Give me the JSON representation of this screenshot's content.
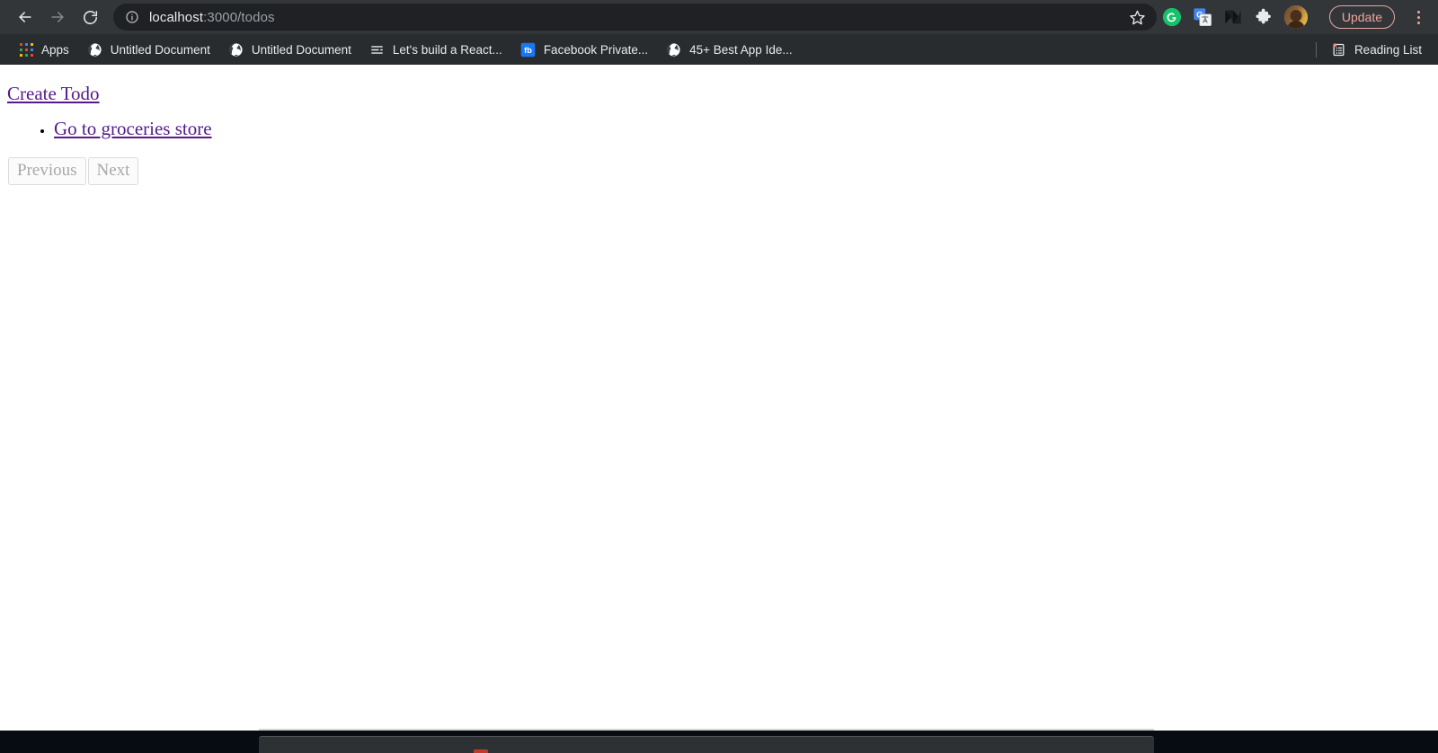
{
  "browser": {
    "toolbar": {
      "back_label": "Back",
      "forward_label": "Forward",
      "reload_label": "Reload",
      "info_label": "Site information",
      "url_host": "localhost",
      "url_rest": ":3000/todos",
      "bookmark_star_label": "Bookmark this tab",
      "extensions": [
        {
          "name": "grammarly-extension-icon",
          "label": "Grammarly"
        },
        {
          "name": "google-translate-extension-icon",
          "label": "Google Translate"
        },
        {
          "name": "medium-extension-icon",
          "label": "Medium"
        },
        {
          "name": "extensions-puzzle-icon",
          "label": "Extensions"
        }
      ],
      "avatar_label": "Profile",
      "update_label": "Update",
      "menu_label": "Customize and control Google Chrome",
      "accent_update": "#f0a39c",
      "bg_toolbar": "#323639",
      "bg_omnibox": "#202124"
    },
    "bookmarks_bar": {
      "bg": "#292c2f",
      "items": [
        {
          "label": "Apps",
          "icon": "apps-grid-icon"
        },
        {
          "label": "Untitled Document",
          "icon": "globe-icon"
        },
        {
          "label": "Untitled Document",
          "icon": "globe-icon"
        },
        {
          "label": "Let's build a React...",
          "icon": "list-lines-icon"
        },
        {
          "label": "Facebook Private...",
          "icon": "facebook-icon"
        },
        {
          "label": "45+ Best App Ide...",
          "icon": "globe-icon"
        }
      ],
      "reading_list_label": "Reading List",
      "reading_list_icon": "reading-list-icon"
    }
  },
  "page": {
    "create_todo_label": "Create Todo",
    "todos": [
      {
        "label": "Go to groceries store"
      }
    ],
    "pagination": {
      "previous_label": "Previous",
      "next_label": "Next"
    },
    "link_color": "#551a8b",
    "background": "#ffffff"
  },
  "os": {
    "taskbar_bg": "#070b12",
    "panel_bg": "#2e3134"
  }
}
